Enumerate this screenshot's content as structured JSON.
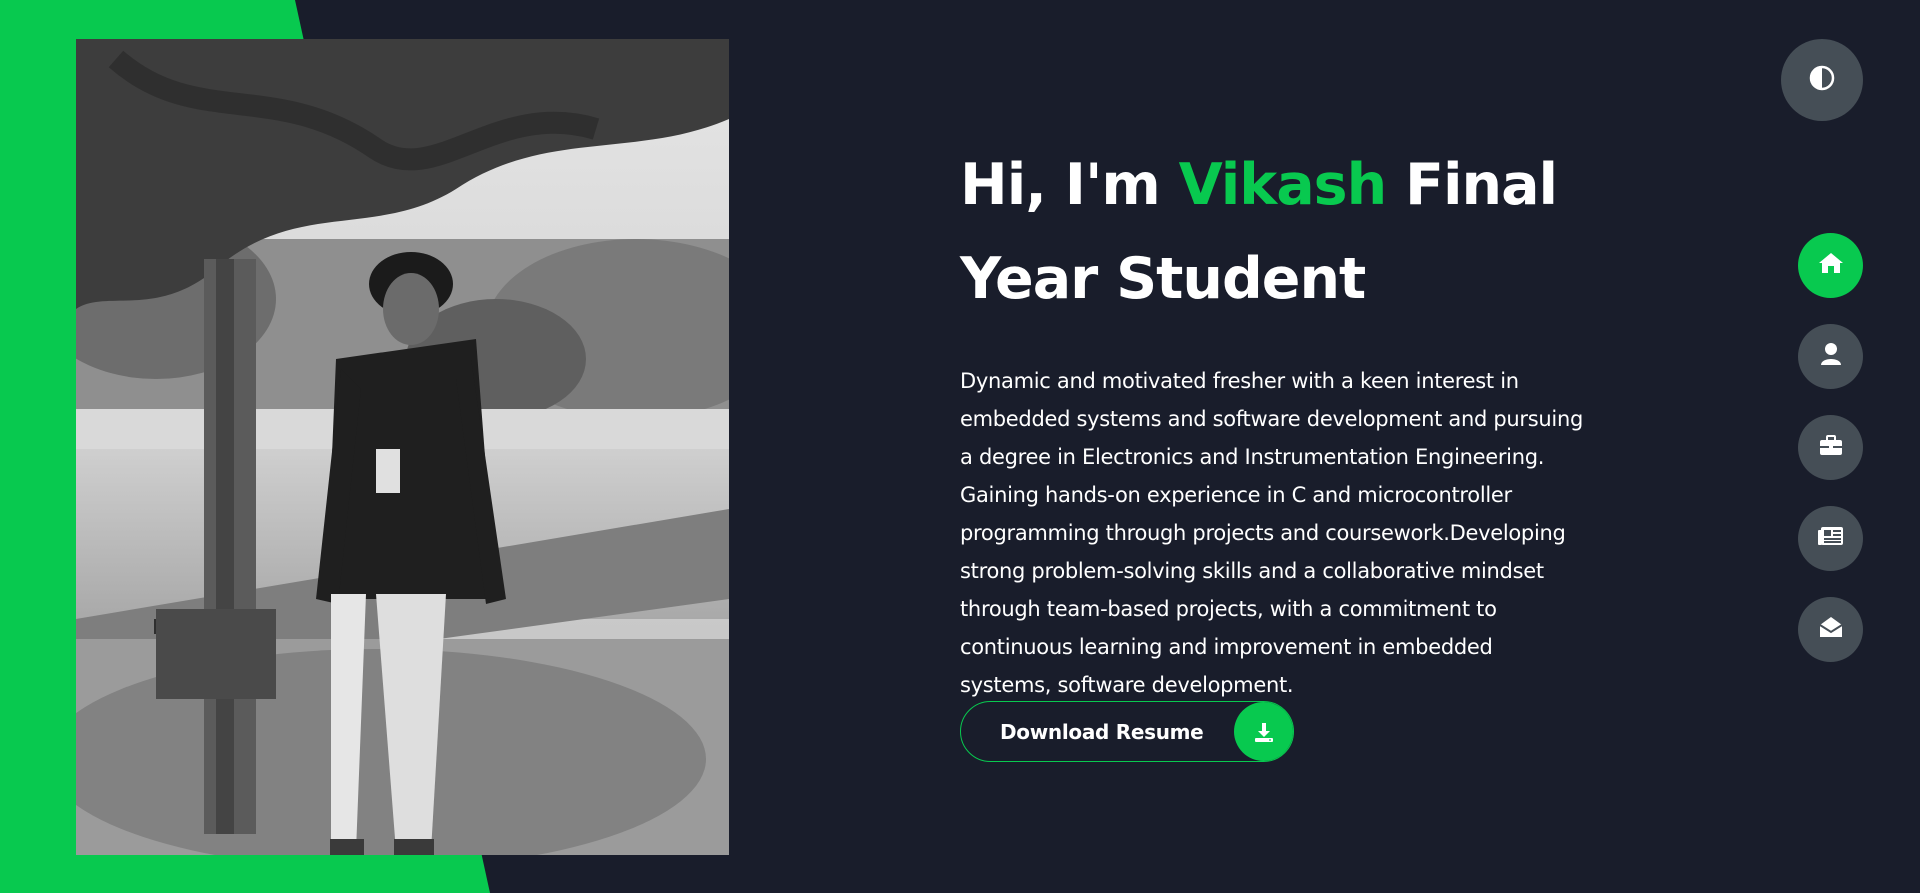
{
  "hero": {
    "title_prefix": "Hi, I'm ",
    "title_name": "Vikash",
    "title_suffix": " Final Year Student",
    "description": "Dynamic and motivated fresher with a keen interest in embedded systems and software development and pursuing a degree in Electronics and Instrumentation Engineering. Gaining hands-on experience in C and microcontroller programming through projects and coursework.Developing strong problem-solving skills and a collaborative mindset through team-based projects, with a commitment to continuous learning and improvement in embedded systems, software development.",
    "resume_button_label": "Download Resume"
  },
  "nav": {
    "items": [
      {
        "icon": "home-icon",
        "active": true
      },
      {
        "icon": "user-icon",
        "active": false
      },
      {
        "icon": "briefcase-icon",
        "active": false
      },
      {
        "icon": "newspaper-icon",
        "active": false
      },
      {
        "icon": "envelope-open-icon",
        "active": false
      }
    ]
  },
  "theme_toggle": {
    "icon": "half-circle-icon"
  },
  "colors": {
    "background": "#191d2b",
    "accent": "#08c94f",
    "button_gray": "#454e56",
    "text": "#ffffff"
  }
}
